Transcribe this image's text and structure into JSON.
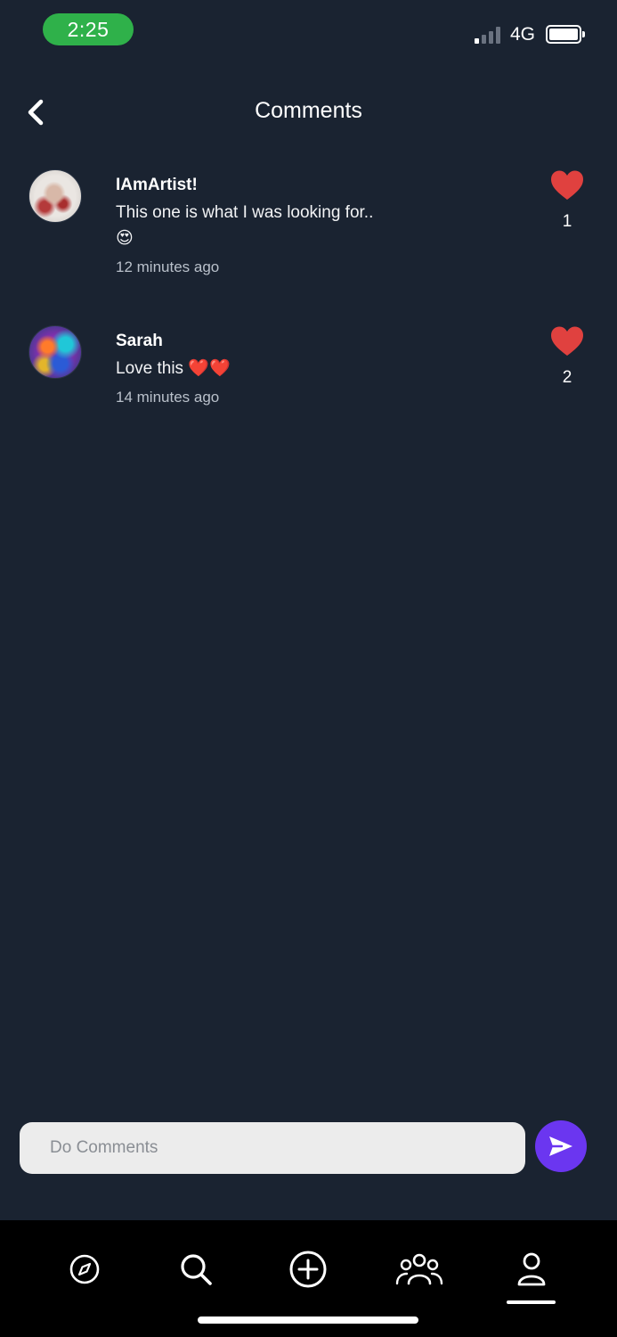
{
  "status_bar": {
    "time": "2:25",
    "network": "4G",
    "time_pill_color": "#2fb14a",
    "signal_bars_on": 1,
    "signal_bars_total": 4,
    "battery_level": 1.0
  },
  "header": {
    "title": "Comments",
    "back_icon": "chevron-left-icon"
  },
  "comments": [
    {
      "user": "IAmArtist!",
      "text": "This one is what I was looking for..",
      "emoji": "😍",
      "time": "12 minutes ago",
      "likes": "1",
      "like_icon": "heart-icon"
    },
    {
      "user": "Sarah",
      "text": "Love this ❤️❤️",
      "emoji": "",
      "time": "14 minutes ago",
      "likes": "2",
      "like_icon": "heart-icon"
    }
  ],
  "composer": {
    "placeholder": "Do Comments",
    "send_icon": "send-icon",
    "send_color": "#6b36f0"
  },
  "nav": {
    "items": [
      "compass-icon",
      "search-icon",
      "add-icon",
      "community-icon",
      "profile-icon"
    ],
    "active": "profile-icon"
  },
  "colors": {
    "background": "#1a2331",
    "heart": "#e0413f",
    "nav_background": "#000000"
  }
}
